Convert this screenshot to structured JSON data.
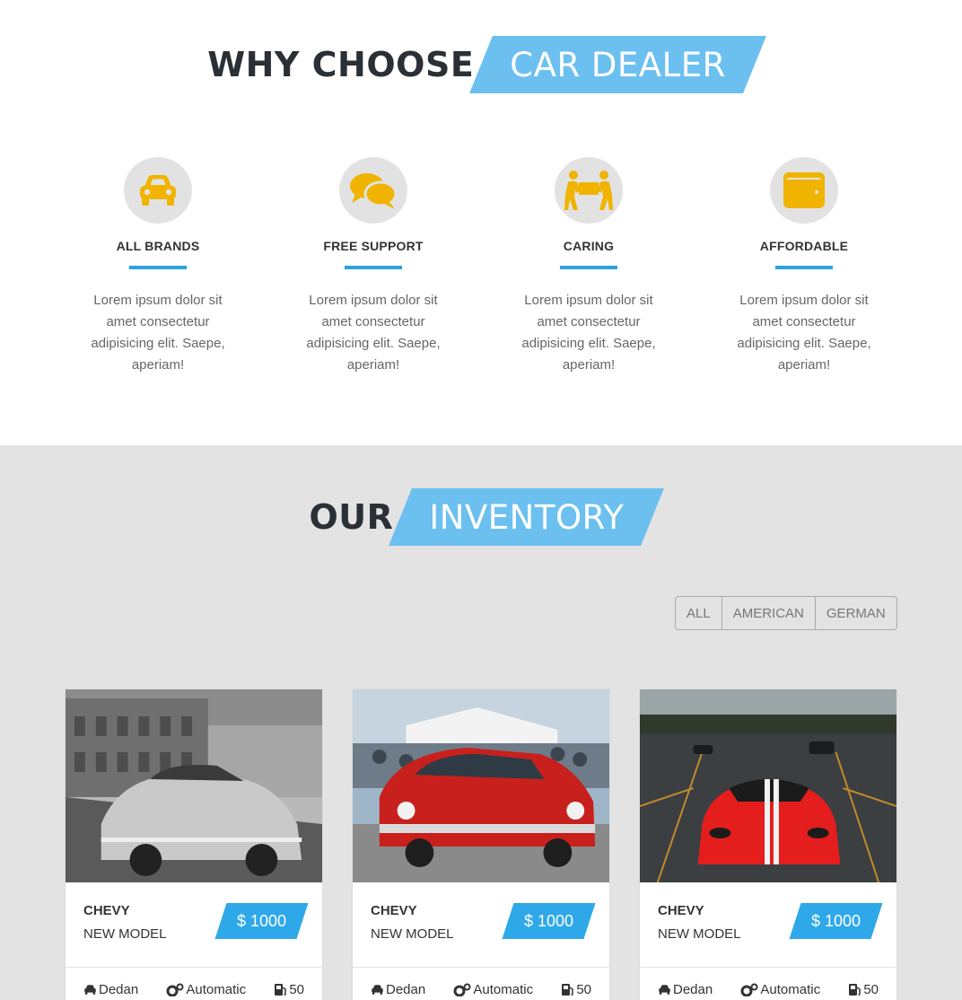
{
  "why": {
    "heading_plain": "WHY CHOOSE",
    "heading_highlight": "CAR DEALER",
    "features": [
      {
        "icon": "car-icon",
        "title": "ALL BRANDS",
        "text": "Lorem ipsum dolor sit amet consectetur adipisicing elit. Saepe, aperiam!"
      },
      {
        "icon": "chat-bubbles-icon",
        "title": "FREE SUPPORT",
        "text": "Lorem ipsum dolor sit amet consectetur adipisicing elit. Saepe, aperiam!"
      },
      {
        "icon": "people-carry-icon",
        "title": "CARING",
        "text": "Lorem ipsum dolor sit amet consectetur adipisicing elit. Saepe, aperiam!"
      },
      {
        "icon": "wallet-icon",
        "title": "AFFORDABLE",
        "text": "Lorem ipsum dolor sit amet consectetur adipisicing elit. Saepe, aperiam!"
      }
    ]
  },
  "inventory": {
    "heading_plain": "OUR",
    "heading_highlight": "INVENTORY",
    "filters": [
      "ALL",
      "AMERICAN",
      "GERMAN"
    ],
    "cars": [
      {
        "make": "CHEVY",
        "model": "NEW MODEL",
        "price": "$ 1000",
        "body": "Dedan",
        "transmission": "Automatic",
        "fuel": "50"
      },
      {
        "make": "CHEVY",
        "model": "NEW MODEL",
        "price": "$ 1000",
        "body": "Dedan",
        "transmission": "Automatic",
        "fuel": "50"
      },
      {
        "make": "CHEVY",
        "model": "NEW MODEL",
        "price": "$ 1000",
        "body": "Dedan",
        "transmission": "Automatic",
        "fuel": "50"
      }
    ]
  },
  "colors": {
    "accent_blue": "#2aa3e0",
    "heading_highlight_bg": "#6cc0f0",
    "icon_yellow": "#f0b400",
    "inventory_bg": "#e3e3e3"
  }
}
